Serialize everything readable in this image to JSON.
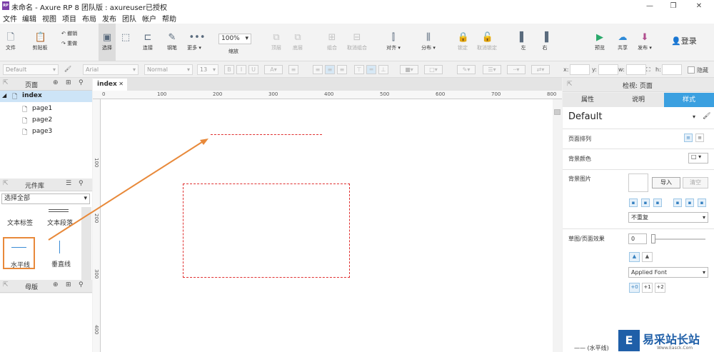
{
  "window": {
    "title": "未命名 - Axure RP 8 团队版 : axureuser已授权",
    "logo": "RP",
    "minimize": "—",
    "restore": "❐",
    "close": "✕"
  },
  "menu": [
    "文件",
    "编辑",
    "视图",
    "项目",
    "布局",
    "发布",
    "团队",
    "帐户",
    "帮助"
  ],
  "toolbar": {
    "file": "文件",
    "clipboard": "剪贴板",
    "cut": "剪切",
    "undo": "撤销",
    "redo": "重做",
    "select": "选择",
    "connect": "连接",
    "pen": "钢笔",
    "more": "更多 ▾",
    "zoom_value": "100%",
    "zoom_label": "缩放",
    "top": "顶层",
    "bottom": "底层",
    "group": "组合",
    "ungroup": "取消组合",
    "align": "对齐 ▾",
    "distribute": "分布 ▾",
    "lock": "锁定",
    "unlock": "取消锁定",
    "left": "左",
    "right": "右",
    "preview": "预览",
    "share": "共享",
    "publish": "发布 ▾",
    "login": "登录"
  },
  "format": {
    "style": "Default",
    "font": "Arial",
    "weight": "Normal",
    "size": "13",
    "bold": "B",
    "italic": "I",
    "underline": "U",
    "x": "x:",
    "y": "y:",
    "w": "w:",
    "h": "h:",
    "hide": "隐藏"
  },
  "pages": {
    "title": "页面",
    "root": "index",
    "items": [
      "page1",
      "page2",
      "page3"
    ]
  },
  "widgets": {
    "title": "元件库",
    "select": "选择全部",
    "items": [
      "文本标签",
      "文本段落",
      "水平线",
      "垂直线"
    ]
  },
  "masters": {
    "title": "母版"
  },
  "canvas": {
    "tab": "index",
    "tab_close": "✕",
    "hruler": [
      "0",
      "100",
      "200",
      "300",
      "400",
      "500",
      "600",
      "700",
      "800"
    ],
    "vruler": [
      "100",
      "200",
      "300",
      "400"
    ]
  },
  "inspector": {
    "title": "检视: 页面",
    "tabs": [
      "属性",
      "说明",
      "样式"
    ],
    "style_name": "Default",
    "page_align": "页面排列",
    "bg_color": "背景颜色",
    "bg_image": "背景图片",
    "import": "导入",
    "clear": "清空",
    "repeat": "不重复",
    "sketch": "草图/页面效果",
    "sketch_value": "0",
    "font": "Applied Font",
    "font_steps": [
      "+0",
      "+1",
      "+2"
    ],
    "hline": "—— (水平线)"
  },
  "watermark": {
    "brand": "易采站长站",
    "sub": "Www.Easck.Com"
  }
}
